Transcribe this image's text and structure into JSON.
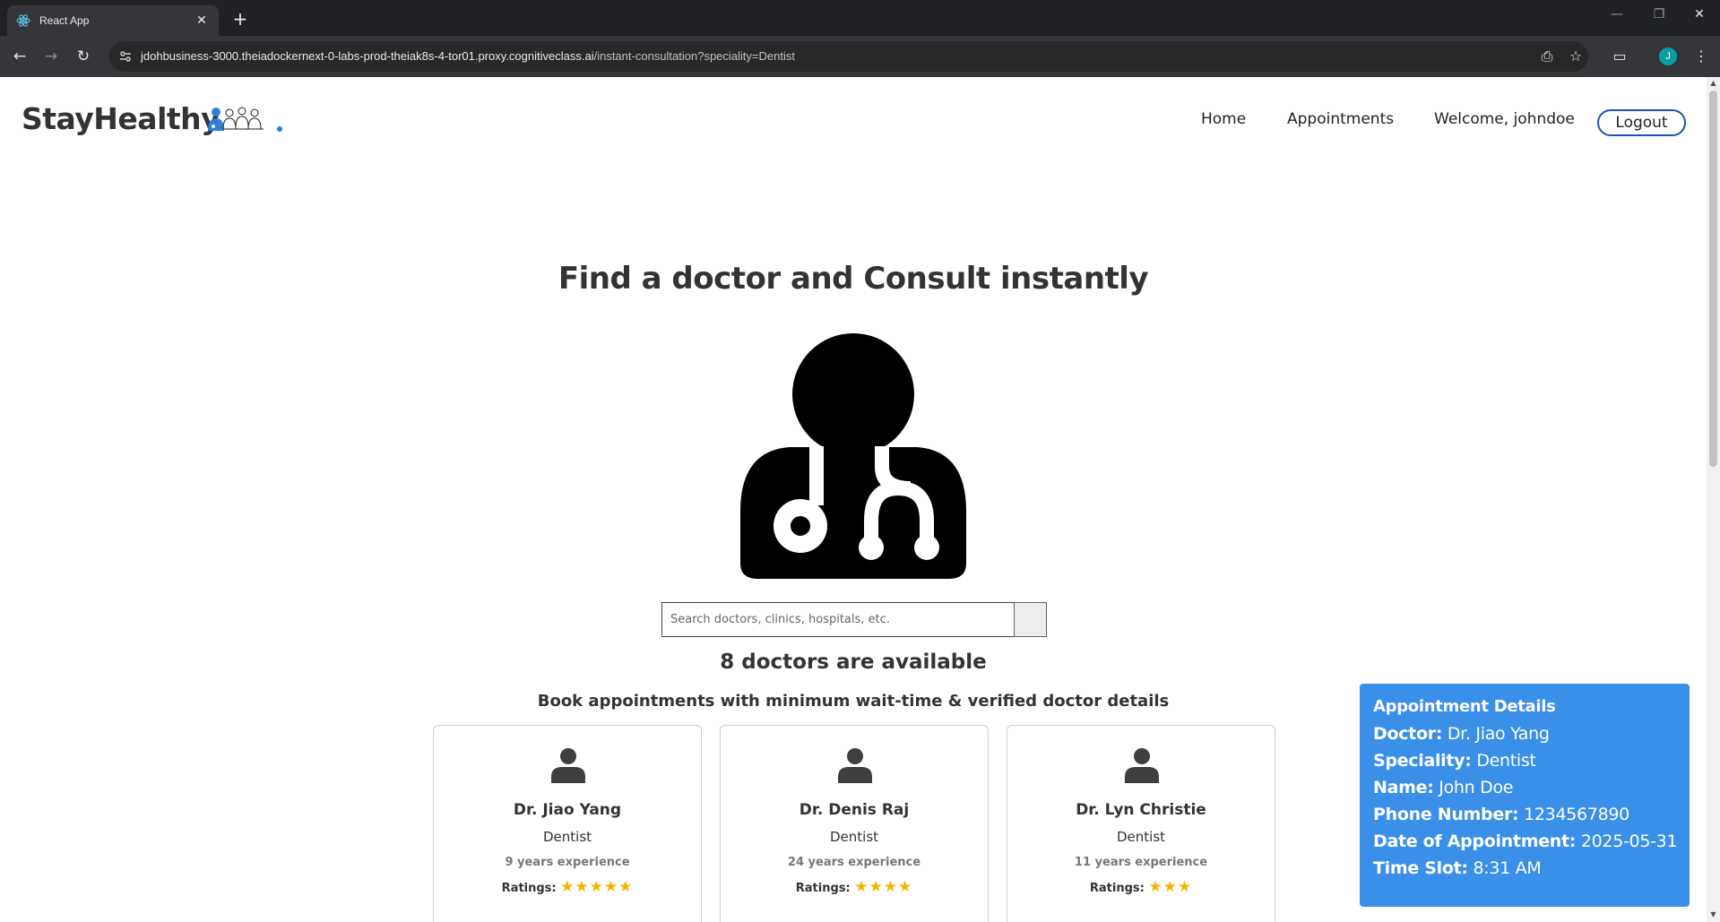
{
  "browser": {
    "tab_title": "React App",
    "url_host": "jdohbusiness-3000.theiadockernext-0-labs-prod-theiak8s-4-tor01.proxy.cognitiveclass.ai",
    "url_path": "/instant-consultation?speciality=Dentist",
    "profile_initial": "J"
  },
  "header": {
    "logo_text": "StayHealthy",
    "nav_home": "Home",
    "nav_appointments": "Appointments",
    "nav_welcome": "Welcome, johndoe",
    "logout_label": "Logout"
  },
  "main": {
    "heading": "Find a doctor and Consult instantly",
    "search_placeholder": "Search doctors, clinics, hospitals, etc.",
    "available_text": "8 doctors are available",
    "subheading": "Book appointments with minimum wait-time & verified doctor details"
  },
  "doctors": [
    {
      "name": "Dr. Jiao Yang",
      "speciality": "Dentist",
      "experience": "9 years experience",
      "ratings_label": "Ratings:",
      "stars": "★★★★★",
      "rating": 5
    },
    {
      "name": "Dr. Denis Raj",
      "speciality": "Dentist",
      "experience": "24 years experience",
      "ratings_label": "Ratings:",
      "stars": "★★★★",
      "rating": 4
    },
    {
      "name": "Dr. Lyn Christie",
      "speciality": "Dentist",
      "experience": "11 years experience",
      "ratings_label": "Ratings:",
      "stars": "★★★",
      "rating": 3
    }
  ],
  "appointment": {
    "title": "Appointment Details",
    "doctor_label": "Doctor:",
    "doctor_value": "Dr. Jiao Yang",
    "speciality_label": "Speciality:",
    "speciality_value": "Dentist",
    "name_label": "Name:",
    "name_value": "John Doe",
    "phone_label": "Phone Number:",
    "phone_value": "1234567890",
    "date_label": "Date of Appointment:",
    "date_value": "2025-05-31",
    "time_label": "Time Slot:",
    "time_value": "8:31 AM"
  },
  "colors": {
    "accent": "#3a8fe8",
    "logout_border": "#1a56b0",
    "star": "#f5b301"
  }
}
